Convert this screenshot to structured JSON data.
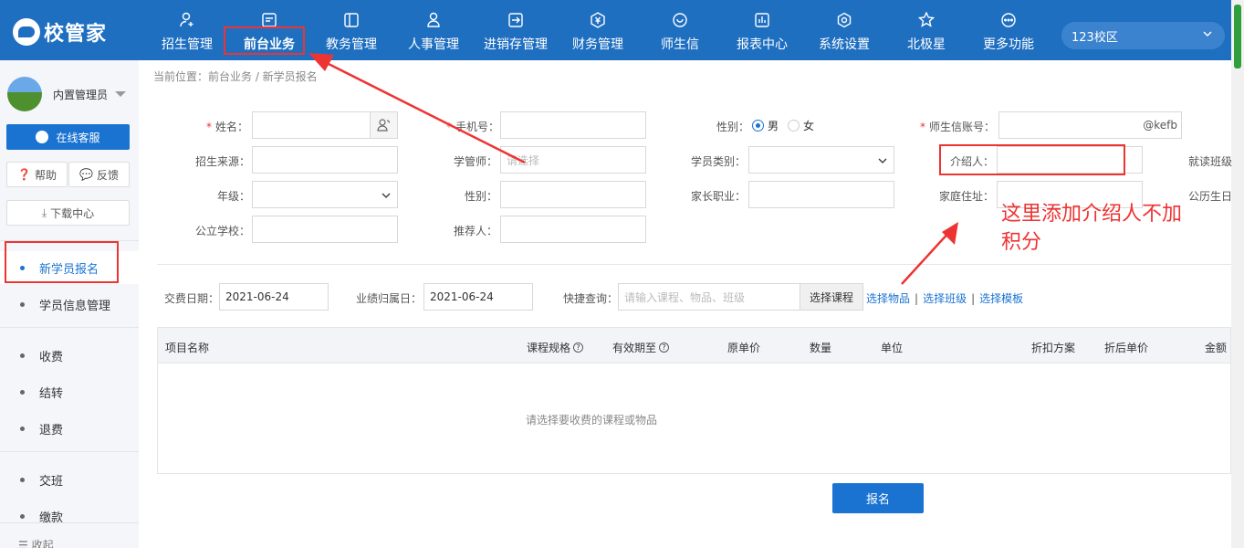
{
  "app": {
    "logo_text": "校管家"
  },
  "nav": {
    "items": [
      {
        "label": "招生管理",
        "icon": "user-add-icon"
      },
      {
        "label": "前台业务",
        "icon": "reception-icon"
      },
      {
        "label": "教务管理",
        "icon": "book-icon"
      },
      {
        "label": "人事管理",
        "icon": "person-icon"
      },
      {
        "label": "进销存管理",
        "icon": "inventory-icon"
      },
      {
        "label": "财务管理",
        "icon": "finance-icon"
      },
      {
        "label": "师生信",
        "icon": "chat-icon"
      },
      {
        "label": "报表中心",
        "icon": "report-icon"
      },
      {
        "label": "系统设置",
        "icon": "settings-icon"
      },
      {
        "label": "北极星",
        "icon": "star-icon"
      },
      {
        "label": "更多功能",
        "icon": "more-icon"
      }
    ],
    "campus": "123校区"
  },
  "sidebar": {
    "username": "内置管理员",
    "service_label": "在线客服",
    "help_label": "帮助",
    "feedback_label": "反馈",
    "download_label": "下载中心",
    "items": [
      {
        "label": "新学员报名",
        "active": true
      },
      {
        "label": "学员信息管理",
        "active": false
      },
      {
        "label": "收费",
        "active": false
      },
      {
        "label": "结转",
        "active": false
      },
      {
        "label": "退费",
        "active": false
      },
      {
        "label": "交班",
        "active": false
      },
      {
        "label": "缴款",
        "active": false
      }
    ],
    "collapse_label": "收起"
  },
  "breadcrumb": "当前位置：前台业务 / 新学员报名",
  "form": {
    "name_label": "姓名：",
    "phone_label": "手机号：",
    "gender_label": "性别：",
    "gender_male": "男",
    "gender_female": "女",
    "account_label": "师生信账号：",
    "account_suffix": "@kefb",
    "source_label": "招生来源：",
    "advisor_label": "学管师：",
    "advisor_placeholder": "请选择",
    "student_type_label": "学员类别：",
    "referrer_label": "介绍人：",
    "class_label": "就读班级",
    "grade_label": "年级：",
    "gender2_label": "性别：",
    "parent_job_label": "家长职业：",
    "address_label": "家庭住址：",
    "public_birth_label": "公历生日",
    "school_label": "公立学校：",
    "recommender_label": "推荐人："
  },
  "annotation": {
    "note_line1": "这里添加介绍人不加",
    "note_line2": "积分"
  },
  "payment": {
    "pay_date_label": "交费日期：",
    "pay_date_value": "2021-06-24",
    "perf_date_label": "业绩归属日：",
    "perf_date_value": "2021-06-24",
    "quick_label": "快捷查询：",
    "quick_placeholder": "请输入课程、物品、班级",
    "choose_course": "选择课程",
    "choose_goods": "选择物品",
    "choose_class": "选择班级",
    "choose_template": "选择模板"
  },
  "table": {
    "headers": [
      "项目名称",
      "课程规格",
      "有效期至",
      "原单价",
      "数量",
      "单位",
      "折扣方案",
      "折后单价",
      "金额"
    ],
    "empty_text": "请选择要收费的课程或物品"
  },
  "submit_label": "报名",
  "colors": {
    "primary": "#1f6fc1",
    "accent": "#1a73d1",
    "annotation": "#e33333"
  }
}
